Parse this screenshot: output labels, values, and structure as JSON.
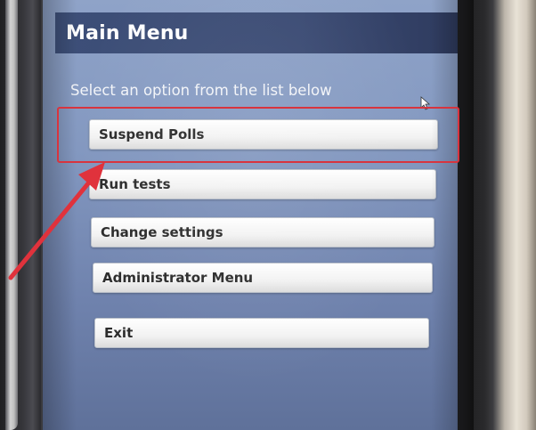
{
  "screen": {
    "title": "Main Menu",
    "instruction": "Select an option from the list below"
  },
  "menu": {
    "items": [
      {
        "label": "Suspend Polls"
      },
      {
        "label": "Run tests"
      },
      {
        "label": "Change settings"
      },
      {
        "label": "Administrator Menu"
      },
      {
        "label": "Exit"
      }
    ]
  },
  "icons": {
    "cursor": "mouse-pointer-icon",
    "annotation_arrow": "arrow-icon"
  },
  "colors": {
    "annotation": "#d8343e",
    "title_bar": "#3d4f78",
    "screen_bg": "#8398c0"
  }
}
